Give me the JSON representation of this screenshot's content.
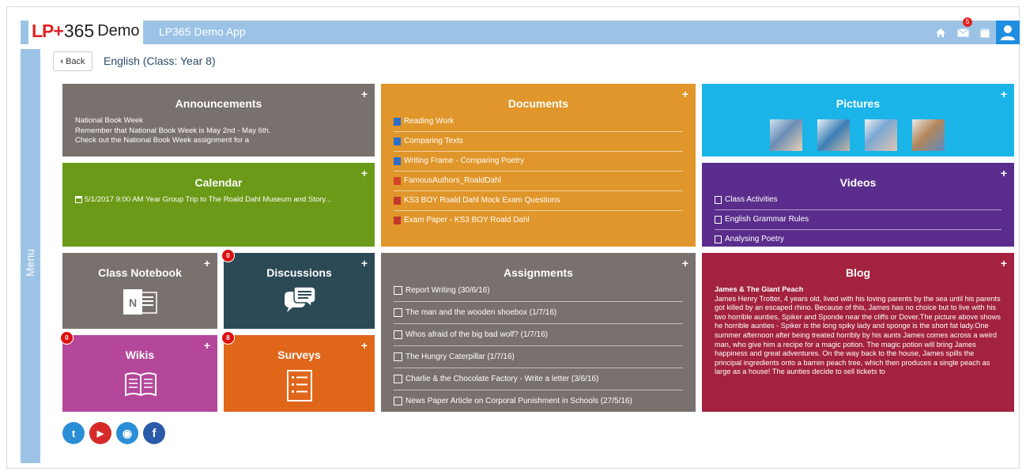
{
  "header": {
    "brand_lp": "LP+",
    "brand_365": "365",
    "brand_demo": "Demo",
    "app_title": "LP365 Demo App",
    "icons": [
      "home-icon",
      "mail-icon",
      "calendar-icon",
      "user-icon"
    ],
    "mail_count": "5"
  },
  "sidebar": {
    "label": "Menu"
  },
  "nav": {
    "back_label": "Back",
    "page_title": "English (Class: Year 8)"
  },
  "tiles": {
    "announcements": {
      "title": "Announcements",
      "lines": [
        "National Book Week",
        "Remember that National Book Week is May 2nd - May 6th.",
        "Check out the National Book Week assignment for a"
      ],
      "color": "#79716e"
    },
    "calendar": {
      "title": "Calendar",
      "event": "5/1/2017 9:00 AM Year Group Trip to The Roald Dahl Museum and Story...",
      "color": "#6a9a17"
    },
    "documents": {
      "title": "Documents",
      "items": [
        "Reading Work",
        "Comparing Texts",
        "Writing Frame - Comparing Poetry",
        "FamousAuthors_RoaldDahl",
        "KS3 BOY Roald Dahl Mock Exam Questions",
        "Exam Paper - KS3 BOY Roald Dahl"
      ],
      "color": "#e0962a"
    },
    "pictures": {
      "title": "Pictures",
      "color": "#1ab4e8"
    },
    "videos": {
      "title": "Videos",
      "items": [
        "Class Activities",
        "English Grammar Rules",
        "Analysing Poetry"
      ],
      "color": "#5a2d8c"
    },
    "notebook": {
      "title": "Class Notebook",
      "color": "#79716e"
    },
    "discussions": {
      "title": "Discussions",
      "badge": "0",
      "color": "#2b4a56"
    },
    "wikis": {
      "title": "Wikis",
      "badge": "0",
      "color": "#b5479a"
    },
    "surveys": {
      "title": "Surveys",
      "badge": "8",
      "color": "#e0661a"
    },
    "assignments": {
      "title": "Assignments",
      "items": [
        "Report Writing (30/6/16)",
        "The man and the wooden shoebox (1/7/16)",
        "Whos afraid of the big bad wolf? (1/7/16)",
        "The Hungry Caterpillar (1/7/16)",
        "Charlie & the Chocolate Factory - Write a letter (3/6/16)",
        "News Paper Article on Corporal Punishment in Schools (27/5/16)"
      ],
      "color": "#79716e"
    },
    "blog": {
      "title": "Blog",
      "post_title": "James & The Giant Peach",
      "post_body": "James Henry Trotter, 4 years old, lived with his loving parents by the sea until his parents got killed by an escaped rhino. Because of this, James has no choice but to live with his two horrible aunties, Spiker and Sponde near the cliffs or Dover.The picture above shows he horrible aunties - Spiker is the long spiky lady and sponge is the short fat lady.One summer afternoon after being treated horribly by his aunts James comes across a weird man, who give him a recipe for a magic potion. The magic potion will bring James happiness and great adventures. On the way back to the house, James spills the principal ingredients onto a barren peach tree, which then produces a single peach as large as a house! The aunties decide to sell tickets to",
      "color": "#a3223f"
    }
  },
  "social": [
    {
      "name": "twitter-icon",
      "glyph": "t",
      "color": "#2a8fd6"
    },
    {
      "name": "youtube-icon",
      "glyph": "▶",
      "color": "#d62a2a"
    },
    {
      "name": "globe-icon",
      "glyph": "◉",
      "color": "#2a8fd6"
    },
    {
      "name": "facebook-icon",
      "glyph": "f",
      "color": "#2b5aa8"
    }
  ],
  "plus_label": "+"
}
